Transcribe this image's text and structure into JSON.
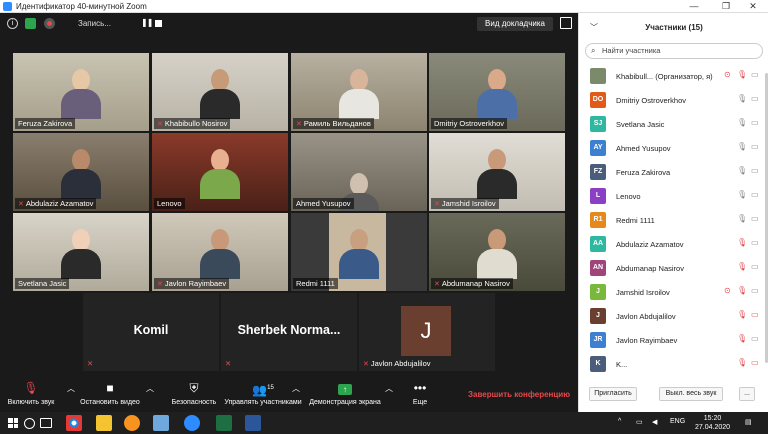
{
  "window": {
    "title": "Идентификатор 40-минутной Zoom",
    "controls": [
      "—",
      "❐",
      "✕"
    ]
  },
  "meeting_top": {
    "recording_label": "Запись...",
    "view_button": "Вид докладчика",
    "icons": [
      "info-icon",
      "lock-icon",
      "record-icon",
      "pause-icon",
      "stop-icon",
      "fullscreen-icon"
    ]
  },
  "tiles": [
    {
      "name": "Feruza Zakirova",
      "muted": false
    },
    {
      "name": "Khabibullo Nosirov",
      "muted": true
    },
    {
      "name": "Рамиль Вильданов",
      "muted": true
    },
    {
      "name": "Dmitriy Ostroverkhov",
      "muted": false
    },
    {
      "name": "Abdulaziz Azamatov",
      "muted": true
    },
    {
      "name": "Lenovo",
      "muted": false
    },
    {
      "name": "Ahmed Yusupov",
      "muted": false
    },
    {
      "name": "Jamshid Isroilov",
      "muted": true
    },
    {
      "name": "Svetlana Jasic",
      "muted": false
    },
    {
      "name": "Javlon Rayimbaev",
      "muted": true
    },
    {
      "name": "Redmi 1111",
      "muted": false
    },
    {
      "name": "Abdumanap Nasirov",
      "muted": true
    }
  ],
  "avatar_tiles": [
    {
      "name": "Komil",
      "small": ""
    },
    {
      "name": "Sherbek Norma...",
      "small": ""
    },
    {
      "name": "J",
      "small": "Javlon Abdujalilov"
    }
  ],
  "toolbar": {
    "audio": "Включить звук",
    "video": "Остановить видео",
    "security": "Безопасность",
    "participants": "Управлять участниками",
    "participants_count": "15",
    "share": "Демонстрация экрана",
    "more": "Еще",
    "end": "Завершить конференцию"
  },
  "panel": {
    "title": "Участники (15)",
    "search_placeholder": "Найти участника",
    "participants": [
      {
        "initials": "",
        "name": "Khabibull... (Организатор, я)",
        "color": "#7a8a6a"
      },
      {
        "initials": "DO",
        "name": "Dmitriy Ostroverkhov",
        "color": "#e05a1a"
      },
      {
        "initials": "SJ",
        "name": "Svetlana Jasic",
        "color": "#2eb8a0"
      },
      {
        "initials": "AY",
        "name": "Ahmed Yusupov",
        "color": "#3d7fd1"
      },
      {
        "initials": "FZ",
        "name": "Feruza Zakirova",
        "color": "#4a5d7a"
      },
      {
        "initials": "L",
        "name": "Lenovo",
        "color": "#8b3fc4"
      },
      {
        "initials": "R1",
        "name": "Redmi 1111",
        "color": "#e58a1a"
      },
      {
        "initials": "AA",
        "name": "Abdulaziz Azamatov",
        "color": "#2eb8a0"
      },
      {
        "initials": "AN",
        "name": "Abdumanap Nasirov",
        "color": "#a0457a"
      },
      {
        "initials": "J",
        "name": "Jamshid Isroilov",
        "color": "#78b83a"
      },
      {
        "initials": "J",
        "name": "Javlon Abdujalilov",
        "color": "#6b3f30"
      },
      {
        "initials": "JR",
        "name": "Javlon Rayimbaev",
        "color": "#3d7fd1"
      },
      {
        "initials": "K",
        "name": "K...",
        "color": "#4a5d7a"
      }
    ],
    "invite": "Пригласить",
    "mute_all": "Выкл. весь звук",
    "more": "..."
  },
  "taskbar": {
    "lang": "ENG",
    "time": "15:20",
    "date": "27.04.2020"
  }
}
